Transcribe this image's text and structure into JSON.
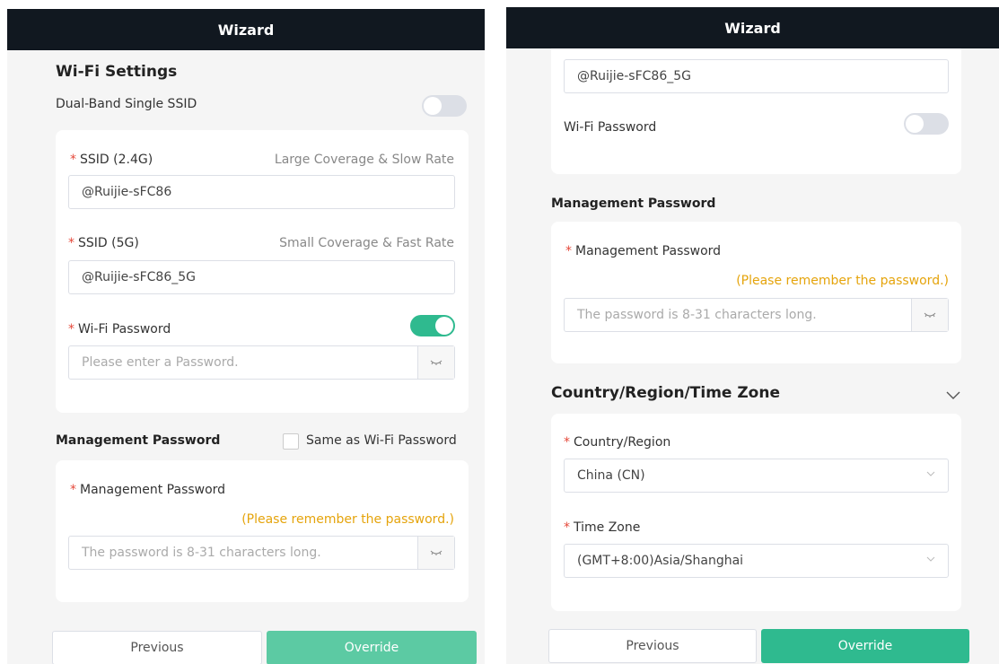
{
  "left": {
    "title": "Wizard",
    "wifi_settings": "Wi-Fi Settings",
    "dual_band": {
      "label": "Dual-Band Single SSID",
      "on": false
    },
    "ssid24": {
      "label": "SSID (2.4G)",
      "hint": "Large Coverage & Slow Rate",
      "value": "@Ruijie-sFC86"
    },
    "ssid5": {
      "label": "SSID (5G)",
      "hint": "Small Coverage & Fast Rate",
      "value": "@Ruijie-sFC86_5G"
    },
    "wifi_password": {
      "label": "Wi-Fi Password",
      "on": true,
      "placeholder": "Please enter a Password."
    },
    "mgmt": {
      "heading": "Management Password",
      "same_as": "Same as Wi-Fi Password",
      "label": "Management Password",
      "remember": "(Please remember the password.)",
      "placeholder": "The password is 8-31 characters long."
    },
    "previous": "Previous",
    "override": "Override"
  },
  "right": {
    "title": "Wizard",
    "ssid5_value": "@Ruijie-sFC86_5G",
    "wifi_password": {
      "label": "Wi-Fi Password",
      "on": false
    },
    "mgmt": {
      "heading": "Management Password",
      "label": "Management Password",
      "remember": "(Please remember the password.)",
      "placeholder": "The password is 8-31 characters long."
    },
    "region": {
      "heading": "Country/Region/Time Zone",
      "country_label": "Country/Region",
      "country_value": "China (CN)",
      "tz_label": "Time Zone",
      "tz_value": "(GMT+8:00)Asia/Shanghai"
    },
    "previous": "Previous",
    "override": "Override"
  },
  "colors": {
    "accent": "#2fba8f",
    "topbar": "#111820",
    "required": "#e5483a",
    "warning": "#e5a40c"
  },
  "icons": [
    "eye-closed-icon",
    "chevron-down-icon"
  ]
}
